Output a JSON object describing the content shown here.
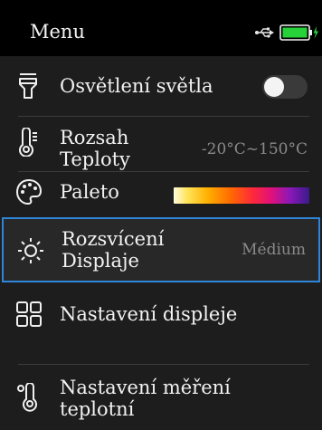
{
  "header": {
    "title": "Menu",
    "usb_icon": "usb-icon",
    "battery_icon": "battery-charging-icon",
    "battery_level": 0.8,
    "battery_color": "#27d13a"
  },
  "menu": {
    "items": [
      {
        "id": "lighting",
        "icon": "flashlight-icon",
        "label": "Osvětlení světla",
        "toggle_on": false
      },
      {
        "id": "temp-range",
        "icon": "thermometer-icon",
        "label_line1": "Rozsah",
        "label_line2": "Teploty",
        "value": "-20°C~150°C"
      },
      {
        "id": "palette",
        "icon": "palette-icon",
        "label": "Paleto"
      },
      {
        "id": "brightness",
        "icon": "brightness-icon",
        "label_line1": "Rozsvícení",
        "label_line2": "Displaje",
        "value": "Médium",
        "selected": true
      },
      {
        "id": "display-settings",
        "icon": "grid-icon",
        "label": "Nastavení displeje"
      },
      {
        "id": "measure-settings",
        "icon": "temperature-icon",
        "label_line1": "Nastavení měření",
        "label_line2": "teplotní"
      }
    ]
  },
  "colors": {
    "background": "#1d1d1d",
    "header_background": "#000000",
    "selection_border": "#2f86d8",
    "value_text": "#8a8a8a"
  }
}
